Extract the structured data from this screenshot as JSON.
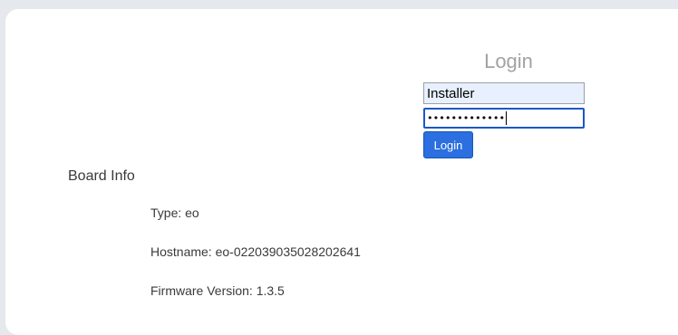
{
  "login": {
    "title": "Login",
    "username_value": "Installer",
    "password_mask": "•••••••••••••",
    "button_label": "Login"
  },
  "board_info": {
    "heading": "Board Info",
    "type": "Type: eo",
    "hostname": "Hostname: eo-022039035028202641",
    "firmware": "Firmware Version: 1.3.5"
  },
  "colors": {
    "page_background": "#e5e8ec",
    "card_background": "#ffffff",
    "accent_button": "#2b6fe0",
    "input_focus_border": "#1a57c9",
    "autofill_background": "#e8f0fe"
  }
}
